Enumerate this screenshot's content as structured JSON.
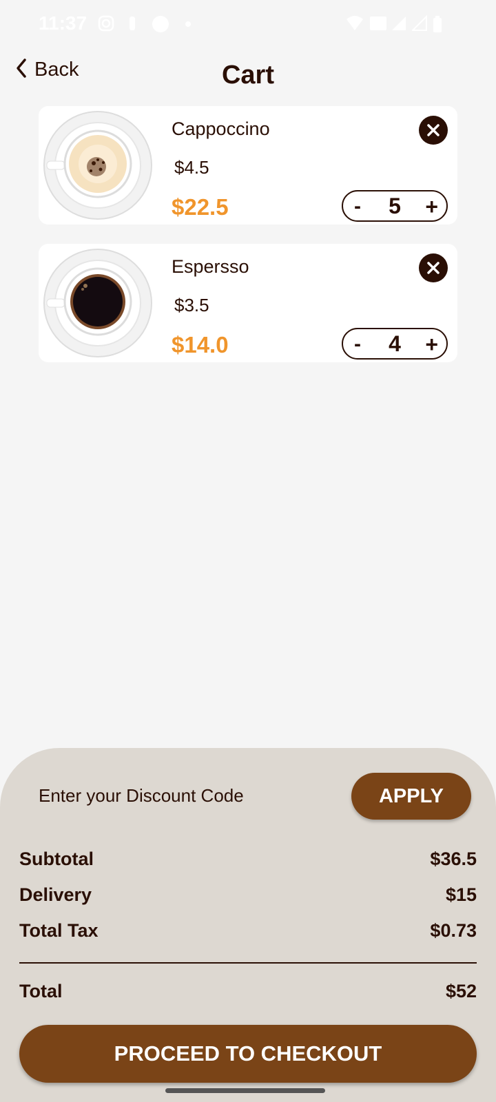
{
  "status_bar": {
    "time": "11:37"
  },
  "header": {
    "back_label": "Back",
    "title": "Cart"
  },
  "cart": {
    "items": [
      {
        "name": "Cappoccino",
        "unit_price": "$4.5",
        "total_price": "$22.5",
        "quantity": "5",
        "minus_label": "-",
        "plus_label": "+"
      },
      {
        "name": "Espersso",
        "unit_price": "$3.5",
        "total_price": "$14.0",
        "quantity": "4",
        "minus_label": "-",
        "plus_label": "+"
      }
    ]
  },
  "summary": {
    "discount_placeholder": "Enter your Discount Code",
    "apply_label": "APPLY",
    "rows": [
      {
        "label": "Subtotal",
        "value": "$36.5"
      },
      {
        "label": "Delivery",
        "value": "$15"
      },
      {
        "label": "Total Tax",
        "value": "$0.73"
      }
    ],
    "total_label": "Total",
    "total_value": "$52",
    "checkout_label": "PROCEED TO CHECKOUT"
  },
  "colors": {
    "accent": "#f0952c",
    "brand_brown": "#7a4417",
    "dark_text": "#2a0f05",
    "panel_bg": "#ddd8d1"
  }
}
